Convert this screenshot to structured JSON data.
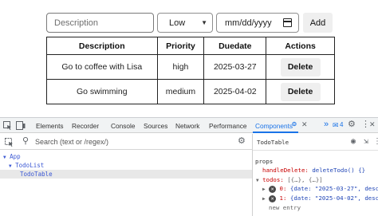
{
  "form": {
    "description_placeholder": "Description",
    "priority_value": "Low",
    "date_placeholder": "mm/dd/yyyy",
    "add_label": "Add"
  },
  "table": {
    "headers": [
      "Description",
      "Priority",
      "Duedate",
      "Actions"
    ],
    "rows": [
      {
        "description": "Go to coffee with Lisa",
        "priority": "high",
        "duedate": "2025-03-27",
        "action": "Delete"
      },
      {
        "description": "Go swimming",
        "priority": "medium",
        "duedate": "2025-04-02",
        "action": "Delete"
      }
    ]
  },
  "devtools": {
    "tabs": [
      "Elements",
      "Recorder",
      "Console",
      "Sources",
      "Network",
      "Performance",
      "Components"
    ],
    "active_tab": "Components",
    "more_tabs": "»",
    "issues_count": "4",
    "search_placeholder": "Search (text or /regex/)",
    "tree": [
      "App",
      "TodoList",
      "TodoTable"
    ],
    "selected_component": "TodoTable",
    "props_heading": "props",
    "props": {
      "handle_delete_key": "handleDelete:",
      "handle_delete_value": "deleteTodo() {}",
      "todos_key": "todos:",
      "todos_value": "[{…}, {…}]",
      "item0_index": "0:",
      "item0_value": "{date: \"2025-03-27\", descrip",
      "item1_index": "1:",
      "item1_value": "{date: \"2025-04-02\", descrip",
      "new_entry": "new entry"
    }
  },
  "colors": {
    "accent": "#1a73e8",
    "prop_key": "#c80000",
    "prop_value": "#1f44b6",
    "tree_node": "#3c59d4"
  }
}
